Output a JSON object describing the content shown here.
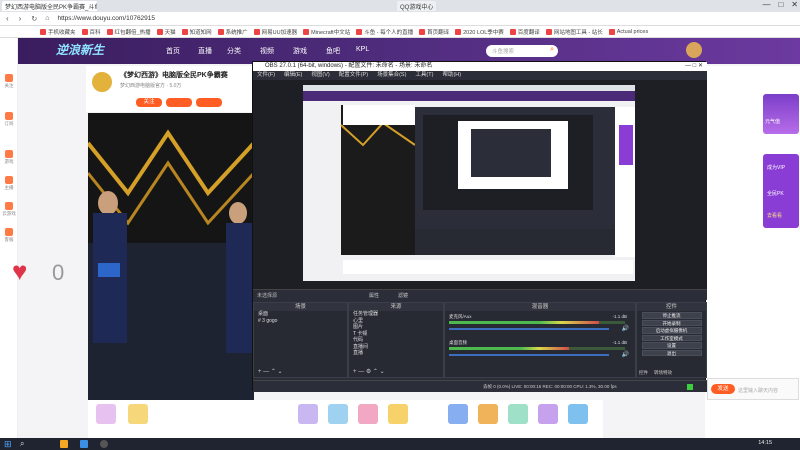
{
  "browser": {
    "tabs": [
      {
        "label": "梦幻西游电脑版全民PK争霸赛_斗鱼",
        "active": true
      },
      {
        "label": "QQ游戏中心",
        "active": false
      }
    ],
    "url": "https://www.douyu.com/10762915",
    "bookmarks": [
      "手机收藏夹",
      "百科",
      "红包翻倍_热播",
      "天猫",
      "知道知网",
      "系统推广",
      "网易UU加速器",
      "Minecraft中文站",
      "斗鱼 - 每个人的直播",
      "首页翻译",
      "首页翻译",
      "2020 LOL季中赛",
      "百度翻译",
      "网站地图工具 - 站长",
      "Actual prices"
    ],
    "window_controls": [
      "—",
      "□",
      "✕"
    ]
  },
  "douyu": {
    "nav": [
      "首页",
      "直播",
      "分类",
      "视频",
      "游戏",
      "鱼吧",
      "KPL"
    ],
    "search_placeholder": "斗鱼搜索",
    "banner_text": "逆浪新生",
    "room_title": "《梦幻西游》电脑版全民PK争霸赛",
    "room_meta": "梦幻西游电脑版官方 · 5.0万",
    "follow_label": "关注",
    "sidebar": [
      "关注",
      "订阅",
      "游戏",
      "主播",
      "云游戏",
      "客服"
    ],
    "like_count": "0",
    "right_labels": [
      "元气值",
      "成为VIP",
      "全民PK",
      "去看看"
    ],
    "send_label": "发送",
    "chat_placeholder": "这里输入聊天内容"
  },
  "obs": {
    "title": "OBS 27.0.1 (64-bit, windows) - 配置文件: 未命名 - 场景: 未命名",
    "menu": [
      "文件(F)",
      "编辑(E)",
      "视图(V)",
      "配置文件(P)",
      "场景集合(S)",
      "工具(T)",
      "帮助(H)"
    ],
    "source_status": "未选择源",
    "properties_label": "属性",
    "filters_label": "滤镜",
    "scenes_title": "场景",
    "scenes": [
      "桌面",
      "# 3 gogo"
    ],
    "sources_title": "来源",
    "sources": [
      "任务管理器",
      "心里",
      "图片",
      "T 卡顿",
      "代码",
      "直播间",
      "直播"
    ],
    "mixer_title": "混音器",
    "mixer": [
      {
        "name": "麦克风/Aux",
        "db": "-1.1 dB"
      },
      {
        "name": "桌面音频",
        "db": "-1.1 dB"
      }
    ],
    "controls_title": "控件",
    "controls": [
      "停止推流",
      "开始录制",
      "启动虚拟摄像机",
      "工作室模式",
      "设置",
      "退出"
    ],
    "controls_tabs": [
      "控件",
      "转场特效"
    ],
    "statusbar": "丢帧 0 (0.0%)   LIVE: 00:00:15   REC: 00:00:00   CPU: 1.3%, 30.00 fps"
  },
  "taskbar": {
    "time": "14:15"
  }
}
